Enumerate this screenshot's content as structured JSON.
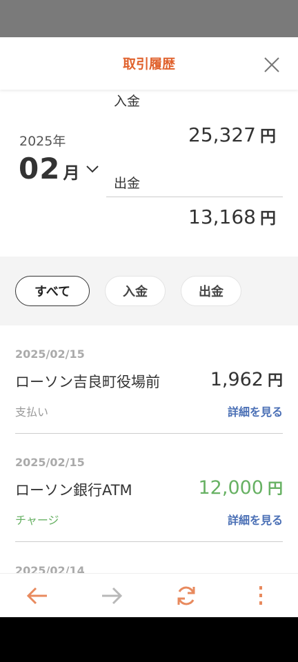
{
  "header": {
    "title": "取引履歴"
  },
  "summary": {
    "year": "2025年",
    "month": "02",
    "month_unit": "月",
    "deposit_label": "入金",
    "deposit_amount": "25,327",
    "withdrawal_label": "出金",
    "withdrawal_amount": "13,168",
    "currency": "円"
  },
  "filters": [
    {
      "label": "すべて",
      "selected": true
    },
    {
      "label": "入金",
      "selected": false
    },
    {
      "label": "出金",
      "selected": false
    }
  ],
  "transactions": [
    {
      "date": "2025/02/15",
      "name": "ローソン吉良町役場前",
      "amount": "1,962",
      "unit": "円",
      "type": "支払い",
      "detail": "詳細を見る"
    },
    {
      "date": "2025/02/15",
      "name": "ローソン銀行ATM",
      "amount": "12,000",
      "unit": "円",
      "type": "チャージ",
      "detail": "詳細を見る"
    },
    {
      "date": "2025/02/14"
    }
  ],
  "colors": {
    "accent": "#e0622d",
    "deposit_green": "#67b163",
    "link_blue": "#4a6fb5"
  },
  "toolbar": {
    "icons": [
      "back-arrow-icon",
      "forward-arrow-icon",
      "refresh-icon",
      "more-vertical-icon"
    ]
  }
}
